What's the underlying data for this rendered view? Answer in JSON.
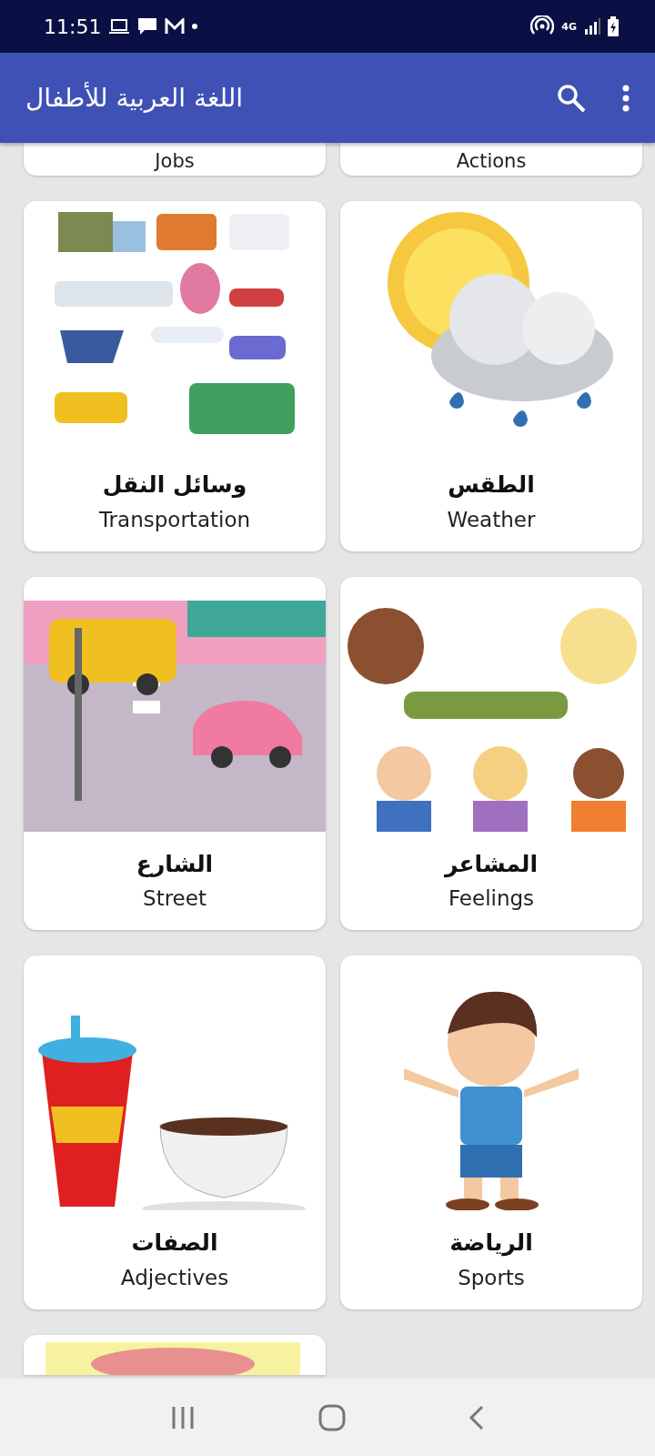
{
  "status_bar": {
    "time": "11:51",
    "network": "4G"
  },
  "app_bar": {
    "title": "اللغة العربية للأطفال"
  },
  "partial_cards": [
    {
      "english": "Actions"
    },
    {
      "english": "Jobs"
    }
  ],
  "cards": [
    {
      "arabic": "الطقس",
      "english": "Weather"
    },
    {
      "arabic": "وسائل النقل",
      "english": "Transportation"
    },
    {
      "arabic": "المشاعر",
      "english": "Feelings"
    },
    {
      "arabic": "الشارع",
      "english": "Street"
    },
    {
      "arabic": "الرياضة",
      "english": "Sports"
    },
    {
      "arabic": "الصفات",
      "english": "Adjectives"
    }
  ]
}
